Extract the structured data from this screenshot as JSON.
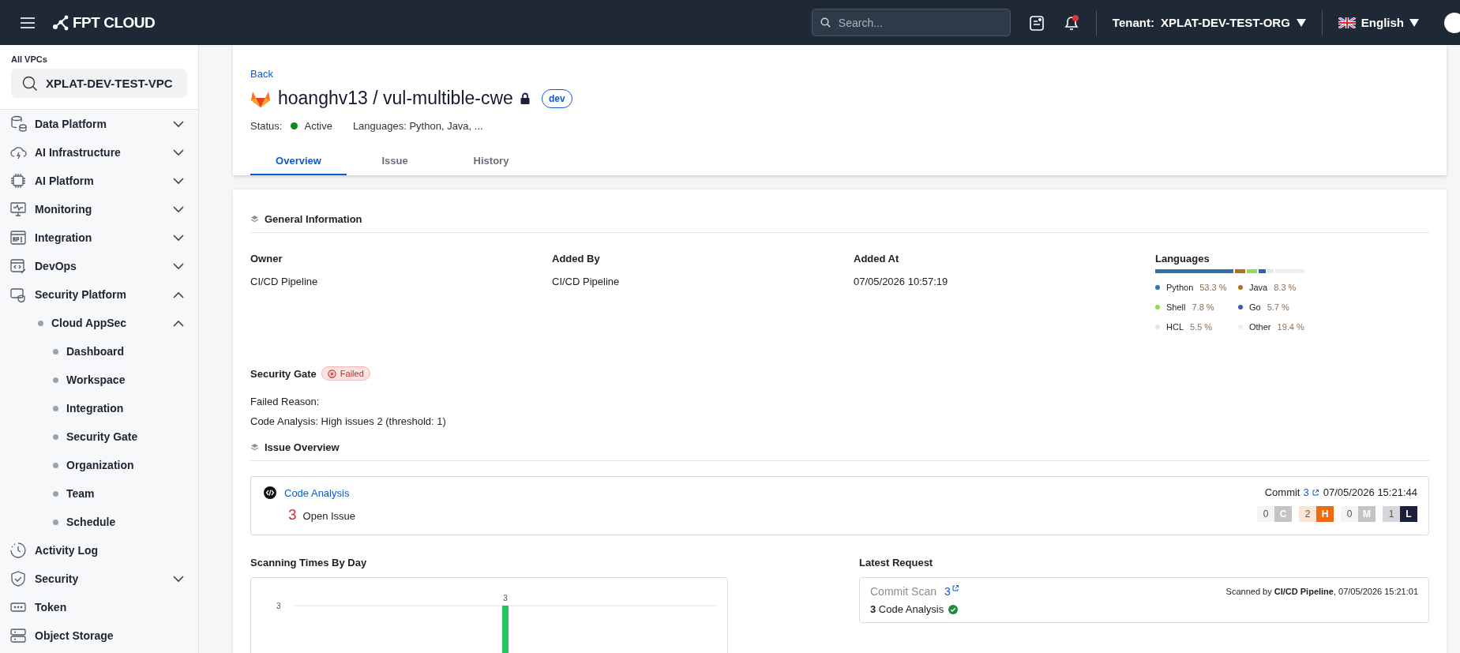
{
  "topbar": {
    "brand": "FPT CLOUD",
    "search": {
      "placeholder": "Search..."
    },
    "tenant_label": "Tenant:",
    "tenant": "XPLAT-DEV-TEST-ORG",
    "language": "English"
  },
  "sidebar": {
    "vpc_label": "All VPCs",
    "vpc": "XPLAT-DEV-TEST-VPC",
    "items": [
      {
        "label": "Data Platform",
        "expanded": false
      },
      {
        "label": "AI Infrastructure",
        "expanded": false
      },
      {
        "label": "AI Platform",
        "expanded": false
      },
      {
        "label": "Monitoring",
        "expanded": false
      },
      {
        "label": "Integration",
        "expanded": false
      },
      {
        "label": "DevOps",
        "expanded": false
      },
      {
        "label": "Security Platform",
        "expanded": true,
        "children": [
          {
            "label": "Cloud AppSec",
            "expanded": true,
            "children": [
              {
                "label": "Dashboard"
              },
              {
                "label": "Workspace"
              },
              {
                "label": "Integration"
              },
              {
                "label": "Security Gate"
              },
              {
                "label": "Organization"
              },
              {
                "label": "Team"
              },
              {
                "label": "Schedule"
              }
            ]
          }
        ]
      },
      {
        "label": "Activity Log"
      },
      {
        "label": "Security",
        "expanded": false
      },
      {
        "label": "Token"
      },
      {
        "label": "Object Storage"
      }
    ]
  },
  "header": {
    "back": "Back",
    "title": "hoanghv13 / vul-multible-cwe",
    "private": true,
    "branch": "dev",
    "status_label": "Status:",
    "status": "Active",
    "languages": "Languages: Python, Java, ...",
    "tabs": [
      {
        "label": "Overview",
        "selected": true
      },
      {
        "label": "Issue",
        "selected": false
      },
      {
        "label": "History",
        "selected": false
      }
    ]
  },
  "general": {
    "title": "General Information",
    "fields": [
      {
        "label": "Owner",
        "value": "CI/CD Pipeline"
      },
      {
        "label": "Added By",
        "value": "CI/CD Pipeline"
      },
      {
        "label": "Added At",
        "value": "07/05/2026 10:57:19"
      }
    ],
    "languages": {
      "title": "Languages",
      "items": [
        {
          "name": "Python",
          "percent": "53.3 %",
          "color": "#3572a5"
        },
        {
          "name": "Java",
          "percent": "8.3 %",
          "color": "#b07219"
        },
        {
          "name": "Shell",
          "percent": "7.8 %",
          "color": "#89e051"
        },
        {
          "name": "Go",
          "percent": "5.7 %",
          "color": "#375eab"
        },
        {
          "name": "HCL",
          "percent": "5.5 %",
          "color": "#e6e6e6"
        },
        {
          "name": "Other",
          "percent": "19.4 %",
          "color": "#ededed"
        }
      ]
    },
    "security_gate": {
      "label": "Security Gate",
      "status": "Failed",
      "passed": false
    },
    "failed_reason_label": "Failed Reason:",
    "failed_reason": "Code Analysis: High issues 2 (threshold: 1)"
  },
  "issue_overview": {
    "title": "Issue Overview",
    "scans": [
      {
        "name": "Code Analysis",
        "count": "3",
        "count_label": "Open Issue",
        "commit_label": "Commit",
        "commit": "3",
        "date": "07/05/2026 15:21:44",
        "severities": [
          {
            "count": "0",
            "letter": "C",
            "color": "#c4c4c4"
          },
          {
            "count": "2",
            "letter": "H",
            "color": "#f26a0e"
          },
          {
            "count": "0",
            "letter": "M",
            "color": "#c4c4c4"
          },
          {
            "count": "1",
            "letter": "L",
            "color": "#1b1f3b"
          }
        ]
      }
    ]
  },
  "scanning": {
    "title": "Scanning Times By Day",
    "tick_label": "3",
    "bar_label": "3"
  },
  "latest": {
    "title": "Latest Request",
    "requests": [
      {
        "type": "Commit Scan",
        "ref": "3",
        "scanned": "Scanned by **CI/CD Pipeline**, 07/05/2026 15:21:01",
        "result": "**3** Code Analysis",
        "passed": true
      }
    ]
  }
}
